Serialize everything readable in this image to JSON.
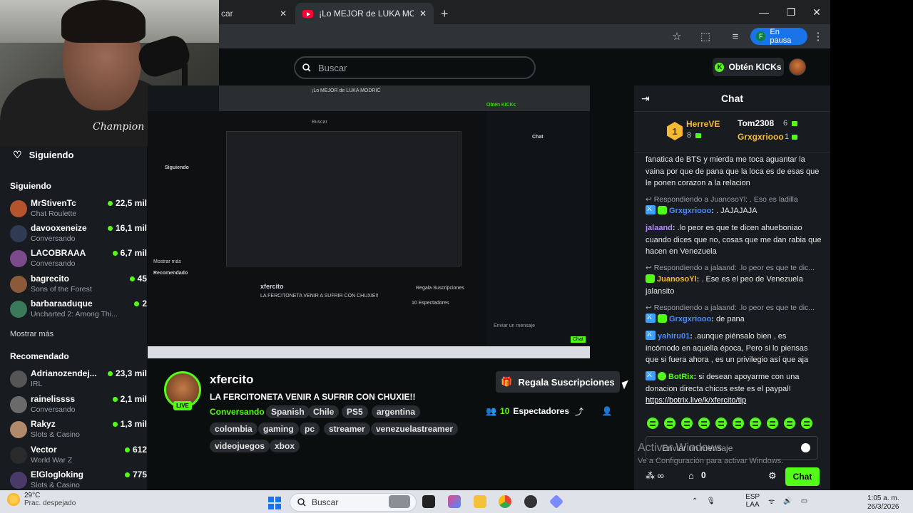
{
  "browser": {
    "tabs": [
      {
        "label": "car"
      },
      {
        "label": "¡Lo MEJOR de LUKA MODRIĆ! C"
      }
    ],
    "new_tab": "+",
    "window_buttons": {
      "minimize": "—",
      "maximize": "❐",
      "close": "✕"
    },
    "profile_initial": "F",
    "profile_status": "En pausa"
  },
  "kick_header": {
    "search_placeholder": "Buscar",
    "kicks_button": "Obtén KICKs",
    "kicks_icon": "K"
  },
  "sidebar": {
    "following_header": "Siguiendo",
    "following_title": "Siguiendo",
    "following": [
      {
        "name": "MrStivenTc",
        "category": "Chat Roulette",
        "viewers": "22,5 mil",
        "color": "#b5532d"
      },
      {
        "name": "davooxeneize",
        "category": "Conversando",
        "viewers": "16,1 mil",
        "color": "#2f3b52"
      },
      {
        "name": "LACOBRAAA",
        "category": "Conversando",
        "viewers": "6,7 mil",
        "color": "#7a4a8a"
      },
      {
        "name": "bagrecito",
        "category": "Sons of the Forest",
        "viewers": "45",
        "color": "#8a5a3a"
      },
      {
        "name": "barbaraaduque",
        "category": "Uncharted 2: Among Thi...",
        "viewers": "2",
        "color": "#3a7a5a"
      }
    ],
    "show_more": "Mostrar más",
    "recommended_title": "Recomendado",
    "recommended": [
      {
        "name": "Adrianozendej...",
        "category": "IRL",
        "viewers": "23,3 mil",
        "color": "#555"
      },
      {
        "name": "rainelissss",
        "category": "Conversando",
        "viewers": "2,1 mil",
        "color": "#6a6a6a"
      },
      {
        "name": "Rakyz",
        "category": "Slots & Casino",
        "viewers": "1,3 mil",
        "color": "#b08a6a"
      },
      {
        "name": "Vector",
        "category": "World War Z",
        "viewers": "612",
        "color": "#2a2a2a"
      },
      {
        "name": "ElGlogloking",
        "category": "Slots & Casino",
        "viewers": "775",
        "color": "#4a3a6a"
      }
    ]
  },
  "webcam": {
    "shirt_logo": "Champion"
  },
  "stream": {
    "streamer": "xfercito",
    "live_badge": "LIVE",
    "title": "LA FERCITONETA VENIR A SUFRIR CON CHUXIE!!",
    "category": "Conversando",
    "tags_row1": [
      "Spanish",
      "Chile",
      "PS5",
      "argentina"
    ],
    "tags_row2": [
      "colombia",
      "gaming",
      "pc",
      "streamer",
      "venezuelastreamer"
    ],
    "tags_row3": [
      "videojuegos",
      "xbox"
    ],
    "gift_button": "Regala Suscripciones",
    "viewers_count": "10",
    "viewers_label": "Espectadores"
  },
  "nested_capture": {
    "tab_label": "¡Lo MEJOR de LUKA MODRIĆ",
    "search": "Buscar",
    "kicks": "Obtén KICKs",
    "chat": "Chat",
    "following": "Siguiendo",
    "streamer": "xfercito",
    "title": "LA FERCITONETA VENIR A SUFRIR CON CHUXIE!!",
    "gift": "Regala Suscripciones",
    "viewers": "10 Espectadores",
    "chat_input": "Enviar un mensaje",
    "send": "Chat",
    "recommended": "Recomendado",
    "show_more": "Mostrar más"
  },
  "chat": {
    "title": "Chat",
    "leaderboard": [
      {
        "name": "HerreVE",
        "count": "8",
        "rank": "1",
        "color": "#f5b932"
      },
      {
        "name": "Tom2308",
        "count": "6",
        "color": "#ffffff"
      },
      {
        "name": "Grxgxriooo",
        "count": "1",
        "color": "#f5b932"
      }
    ],
    "messages": [
      {
        "type": "text",
        "text": "fanatica de BTS y mierda me toca aguantar la vaina por que de pana que la loca es de esas que le ponen corazon a la relacion"
      },
      {
        "type": "reply",
        "text": "Respondiendo a JuanosoYl: . Eso es ladilla"
      },
      {
        "type": "msg",
        "user": "Grxgxriooo",
        "user_color": "#4a8cff",
        "badges": [
          "mod",
          "sub"
        ],
        "text": ". JAJAJAJA"
      },
      {
        "type": "msg",
        "user": "jalaand",
        "user_color": "#b28cff",
        "badges": [],
        "text": ".lo peor es que te dicen ahueboniao cuando dices que no, cosas que me dan rabia que hacen en Venezuela"
      },
      {
        "type": "reply",
        "text": "Respondiendo a jalaand: .lo peor es que te dic..."
      },
      {
        "type": "msg",
        "user": "JuanosoYl",
        "user_color": "#f5b932",
        "badges": [
          "sub"
        ],
        "text": ". Ese es el peo de Venezuela jalansito"
      },
      {
        "type": "reply",
        "text": "Respondiendo a jalaand: .lo peor es que te dic..."
      },
      {
        "type": "msg",
        "user": "Grxgxriooo",
        "user_color": "#4a8cff",
        "badges": [
          "mod",
          "sub"
        ],
        "text": "de pana"
      },
      {
        "type": "msg",
        "user": "yahiru01",
        "user_color": "#4a8cff",
        "badges": [
          "mod"
        ],
        "text": ".aunque piénsalo bien , es incómodo en aquella época, Pero si lo piensas que si fuera ahora , es un privilegio así que aja"
      },
      {
        "type": "msg",
        "user": "BotRix",
        "user_color": "#53fc18",
        "badges": [
          "mod",
          "ver"
        ],
        "text": "si desean apoyarme con una donacion directa chicos este es el paypal!",
        "link": "https://botrix.live/k/xfercito/tip"
      }
    ],
    "input_placeholder": "Enviar un mensaje",
    "footer_count": "0",
    "send_button": "Chat"
  },
  "windows_watermark": {
    "title": "Activar Windows",
    "subtitle": "Ve a Configuración para activar Windows."
  },
  "taskbar": {
    "weather_temp": "29°C",
    "weather_desc": "Prac. despejado",
    "search": "Buscar",
    "lang_top": "ESP",
    "lang_bottom": "LAA",
    "time": "1:05 a. m.",
    "date": "26/3/2026"
  }
}
